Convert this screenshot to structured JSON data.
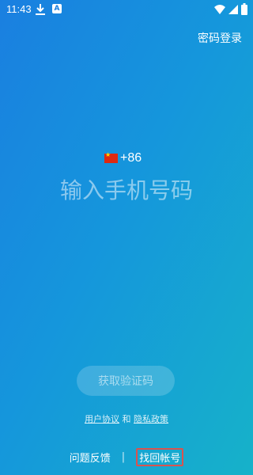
{
  "status_bar": {
    "time": "11:43",
    "icons": [
      "download-icon",
      "a-icon",
      "wifi-icon",
      "signal-icon",
      "battery-icon"
    ]
  },
  "header": {
    "password_login": "密码登录"
  },
  "phone": {
    "country_code": "+86",
    "placeholder": "输入手机号码"
  },
  "verify_button": "获取验证码",
  "agreement": {
    "user_agreement": "用户协议",
    "and": "和",
    "privacy_policy": "隐私政策"
  },
  "footer": {
    "feedback": "问题反馈",
    "separator": "|",
    "recover_account": "找回帐号"
  },
  "colors": {
    "gradient_start": "#1a7fe0",
    "gradient_end": "#16b2c9",
    "highlight_border": "#d9534f"
  }
}
